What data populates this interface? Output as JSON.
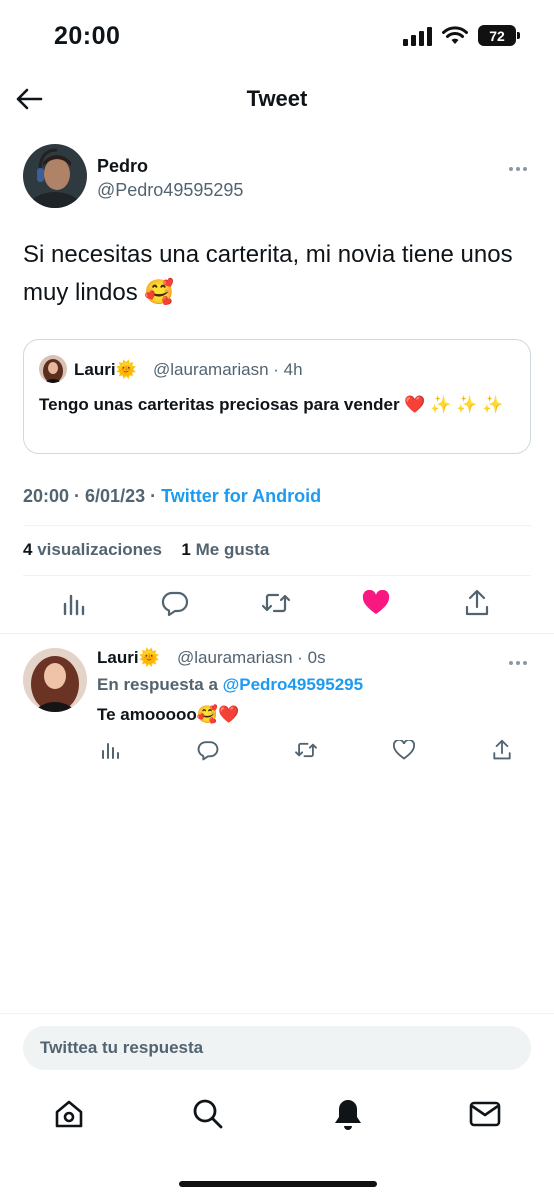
{
  "status_bar": {
    "time": "20:00",
    "battery": "72"
  },
  "header": {
    "title": "Tweet"
  },
  "main_tweet": {
    "author_name": "Pedro",
    "author_handle": "@Pedro49595295",
    "text": "Si necesitas una carterita, mi novia tiene unos muy lindos 🥰",
    "quote": {
      "name": "Lauri🌞",
      "handle_time": "@lauramariasn · 4h",
      "text": "Tengo unas carteritas preciosas para vender ❤️ ✨ ✨ ✨"
    },
    "time_date": "20:00 · 6/01/23 · ",
    "source": "Twitter for Android",
    "views_count": "4",
    "views_label": "visualizaciones",
    "likes_count": "1",
    "likes_label": "Me gusta"
  },
  "reply": {
    "name": "Lauri🌞",
    "handle_time": "@lauramariasn · 0s",
    "replying_prefix": "En respuesta a ",
    "replying_to": "@Pedro49595295",
    "text": "Te amooooo🥰❤️"
  },
  "composer": {
    "placeholder": "Twittea tu respuesta"
  },
  "icons": {
    "back": "arrow-left-icon",
    "analytics": "analytics-icon",
    "reply": "reply-icon",
    "retweet": "retweet-icon",
    "like": "heart-icon",
    "share": "share-icon",
    "home": "home-icon",
    "search": "search-icon",
    "notifications": "bell-icon",
    "messages": "mail-icon"
  },
  "colors": {
    "accent": "#1d9bf0",
    "like": "#f91880",
    "muted": "#536471"
  }
}
